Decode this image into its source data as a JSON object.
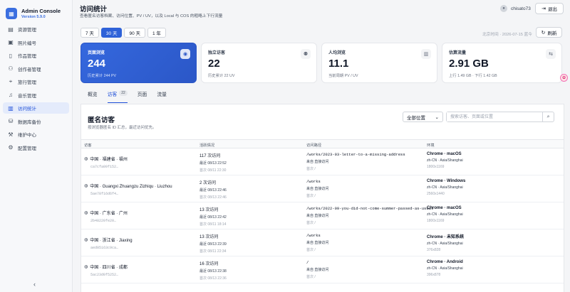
{
  "brand": {
    "name": "Admin Console",
    "version": "Version 5.9.0",
    "logo_icon": "grid-icon"
  },
  "sidebar": {
    "items": [
      {
        "label": "资源管理",
        "icon": "layers-icon"
      },
      {
        "label": "照片编号",
        "icon": "image-icon"
      },
      {
        "label": "作品管理",
        "icon": "file-icon"
      },
      {
        "label": "创作者管理",
        "icon": "users-icon"
      },
      {
        "label": "旅行管理",
        "icon": "map-pin-icon"
      },
      {
        "label": "音乐管理",
        "icon": "headphones-icon"
      },
      {
        "label": "访问统计",
        "icon": "bar-chart-icon",
        "active": true
      },
      {
        "label": "数据库备份",
        "icon": "database-icon"
      },
      {
        "label": "维护中心",
        "icon": "wrench-icon"
      },
      {
        "label": "配置管理",
        "icon": "settings-icon"
      }
    ],
    "collapse_label": "‹"
  },
  "header": {
    "title": "访问统计",
    "description": "查看匿名访客档案、访问位置、PV / UV，以及 Local 与 COS 的粗略上下行流量",
    "user": "chisato73",
    "logout_label": "退出"
  },
  "toolbar": {
    "ranges": [
      "7 天",
      "30 天",
      "90 天",
      "1 年"
    ],
    "active_range": "30 天",
    "timestamp": "北京时间 · 2026-07-15 蓝今",
    "refresh_label": "刷新"
  },
  "stats": [
    {
      "label": "页面浏览",
      "value": "244",
      "sub": "历史累计 244 PV",
      "icon": "eye-icon",
      "highlight": true
    },
    {
      "label": "独立访客",
      "value": "22",
      "sub": "历史累计 22 UV",
      "icon": "user-check-icon"
    },
    {
      "label": "人均浏览",
      "value": "11.1",
      "sub": "当前周期 PV / UV",
      "icon": "chart-icon"
    },
    {
      "label": "估算流量",
      "value": "2.91 GB",
      "sub": "上行 1.49 GB · 下行 1.42 GB",
      "icon": "transfer-icon"
    }
  ],
  "tabs": [
    {
      "label": "概览"
    },
    {
      "label": "访客",
      "count": "22",
      "active": true
    },
    {
      "label": "页面"
    },
    {
      "label": "流量"
    }
  ],
  "panel": {
    "title": "匿名访客",
    "description": "按浏览器匿名 ID 汇总，最近访问优先。",
    "location_select": "全部位置",
    "search_placeholder": "搜索访客、页面或位置",
    "columns": [
      "访客",
      "活跃情况",
      "访问路径",
      "环境"
    ]
  },
  "rows": [
    {
      "location": "中国 · 福建省 · 福州",
      "id": "ca7cfa09f152…",
      "visits": "117 次访问",
      "latest": "最近 08/13 22:52",
      "first": "首次 08/11 22:30",
      "path": "/works/2023-03-letter-to-a-missing-address",
      "via": "来自 直接访问",
      "first_path": "首次 /",
      "browser": "Chrome · macOS",
      "locale": "zh-CN · Asia/Shanghai",
      "screen": "1800x1169"
    },
    {
      "location": "中国 · Guangxi Zhuangzu Zizhiqu · Liuzhou",
      "id": "5ae78f16d6f4…",
      "visits": "2 次访问",
      "latest": "最近 08/13 22:46",
      "first": "首次 08/13 22:46",
      "path": "/works",
      "via": "来自 直接访问",
      "first_path": "首次 /",
      "browser": "Chrome · Windows",
      "locale": "zh-CN · Asia/Shanghai",
      "screen": "2560x1440"
    },
    {
      "location": "中国 · 广东省 · 广州",
      "id": "2b48220fe20…",
      "visits": "13 次访问",
      "latest": "最近 08/13 22:42",
      "first": "首次 08/11 18:14",
      "path": "/works/2022-09-you-did-not-come-summer-passed-as-usual",
      "via": "来自 直接访问",
      "first_path": "首次 /",
      "browser": "Chrome · macOS",
      "locale": "zh-CN · Asia/Shanghai",
      "screen": "1800x1169"
    },
    {
      "location": "中国 · 浙江省 · Jiaxing",
      "id": "aed05163c9ca…",
      "visits": "13 次访问",
      "latest": "最近 08/13 22:39",
      "first": "首次 08/11 22:34",
      "path": "/works",
      "via": "来自 直接访问",
      "first_path": "首次 /",
      "browser": "Chrome · 未知系统",
      "locale": "zh-CN · Asia/Shanghai",
      "screen": "376x828"
    },
    {
      "location": "中国 · 四川省 · 成都",
      "id": "5ac23d0f5252…",
      "visits": "16 次访问",
      "latest": "最近 08/13 22:38",
      "first": "首次 08/13 22:36",
      "path": "/",
      "via": "来自 直接访问",
      "first_path": "首次 /",
      "browser": "Chrome · Android",
      "locale": "zh-CN · Asia/Shanghai",
      "screen": "396x878"
    }
  ],
  "float_button_icon": "assistant-icon"
}
